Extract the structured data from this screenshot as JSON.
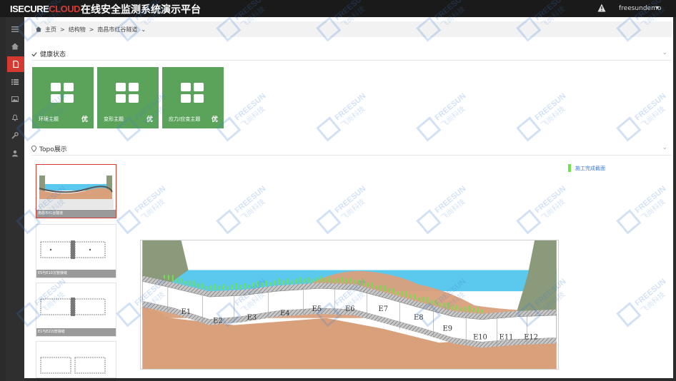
{
  "header": {
    "logo_part1": "ISECURE",
    "logo_part2": "CLOUD",
    "title": "在线安全监测系统演示平台",
    "username": "freesundemo",
    "warning_icon": "warning-icon"
  },
  "sidebar": {
    "items": [
      {
        "icon": "menu-icon"
      },
      {
        "icon": "home-icon"
      },
      {
        "icon": "document-icon",
        "active": true
      },
      {
        "icon": "list-icon"
      },
      {
        "icon": "image-icon"
      },
      {
        "icon": "bell-icon"
      },
      {
        "icon": "wrench-icon"
      },
      {
        "icon": "user-icon"
      }
    ]
  },
  "breadcrumb": {
    "home": "主页",
    "sep1": ">",
    "structures": "结构物",
    "sep2": ">",
    "current": "南昌市红谷隧道",
    "caret": "⌄"
  },
  "health": {
    "title": "健康状态",
    "tiles": [
      {
        "label": "环境主题",
        "rating": "优"
      },
      {
        "label": "变形主题",
        "rating": "优"
      },
      {
        "label": "应力/应变主题",
        "rating": "优"
      }
    ]
  },
  "topo": {
    "title": "Topo展示",
    "thumbnails": [
      {
        "caption": "南昌市红谷隧道"
      },
      {
        "caption": "E5与E10沉管接缝"
      },
      {
        "caption": "E1与E2沉管接缝"
      },
      {
        "caption": ""
      }
    ],
    "legend_label": "施工完成截面",
    "segments": [
      "E1",
      "E2",
      "E3",
      "E4",
      "E5",
      "E6",
      "E7",
      "E8",
      "E9",
      "E10",
      "E11",
      "E12"
    ]
  },
  "watermark": {
    "text_en": "FREESUN",
    "text_cn": "飞尚科技"
  },
  "colors": {
    "accent": "#d43a2f",
    "tile_green": "#5ba35a",
    "water": "#5bc8ee",
    "soil": "#d9a07c",
    "sensor": "#6fe34a"
  }
}
